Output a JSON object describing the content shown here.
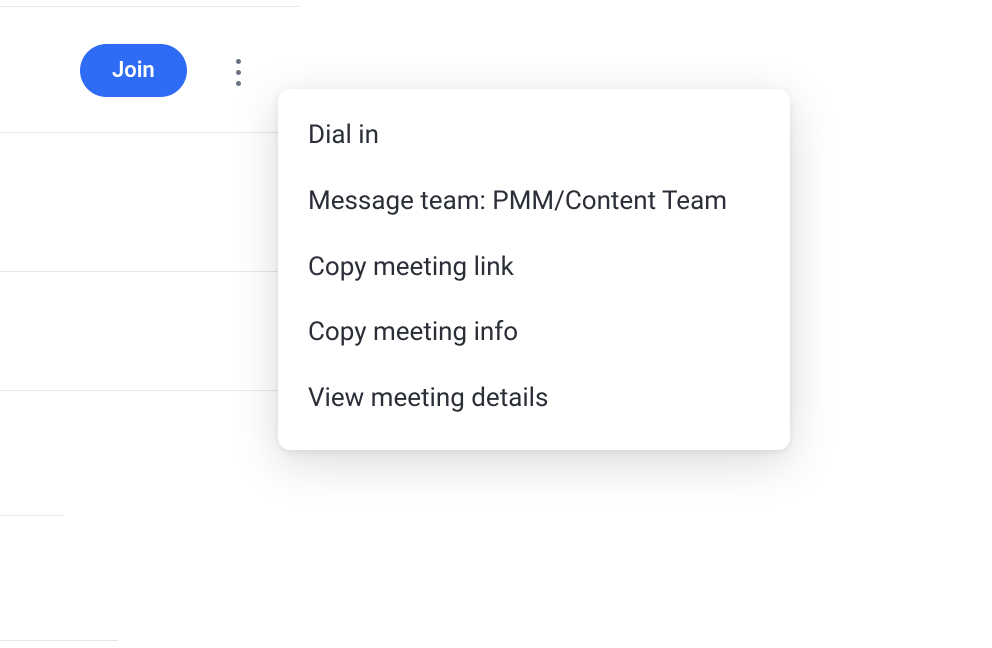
{
  "toolbar": {
    "join_label": "Join"
  },
  "menu": {
    "items": [
      {
        "label": "Dial in"
      },
      {
        "label": "Message team: PMM/Content Team"
      },
      {
        "label": "Copy meeting link"
      },
      {
        "label": "Copy meeting info"
      },
      {
        "label": "View meeting details"
      }
    ]
  }
}
